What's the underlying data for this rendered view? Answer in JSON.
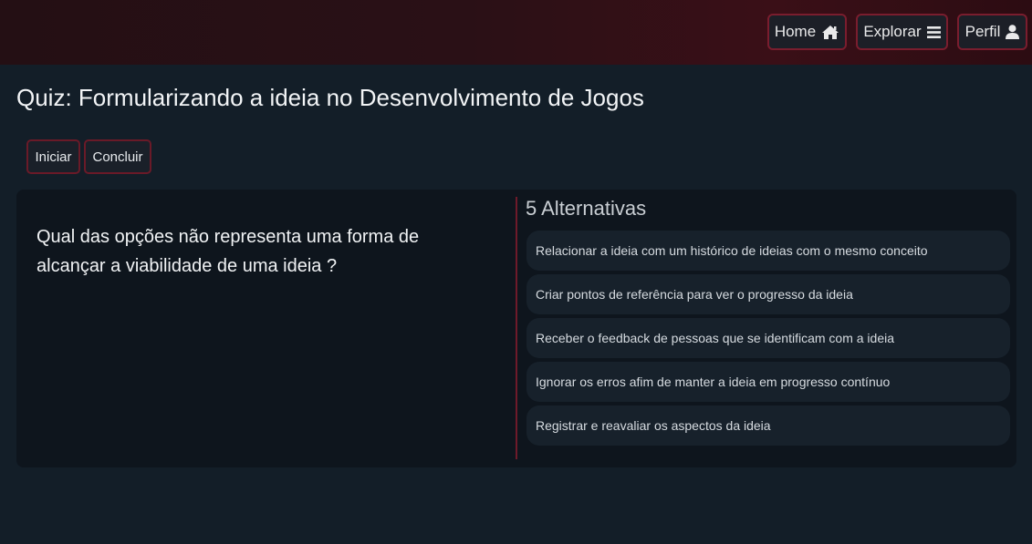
{
  "nav": {
    "home_label": "Home",
    "explorar_label": "Explorar",
    "perfil_label": "Perfil",
    "icons": [
      "home-icon",
      "menu-icon",
      "user-icon"
    ]
  },
  "quiz": {
    "title": "Quiz: Formularizando a ideia no Desenvolvimento de Jogos",
    "iniciar_label": "Iniciar",
    "concluir_label": "Concluir",
    "question": "Qual das opções não representa uma forma de alcançar a viabilidade de uma ideia ?",
    "alternatives_title": "5 Alternativas",
    "alternatives": [
      "Relacionar a ideia com um histórico de ideias com o mesmo conceito",
      "Criar pontos de referência para ver o progresso da ideia",
      "Receber o feedback de pessoas que se identificam com a ideia",
      "Ignorar os erros afim de manter a ideia em progresso contínuo",
      "Registrar e reavaliar os aspectos da ideia"
    ]
  },
  "colors": {
    "accent_border": "#7a1d2e",
    "background": "#131e28",
    "card": "#0e151d"
  }
}
